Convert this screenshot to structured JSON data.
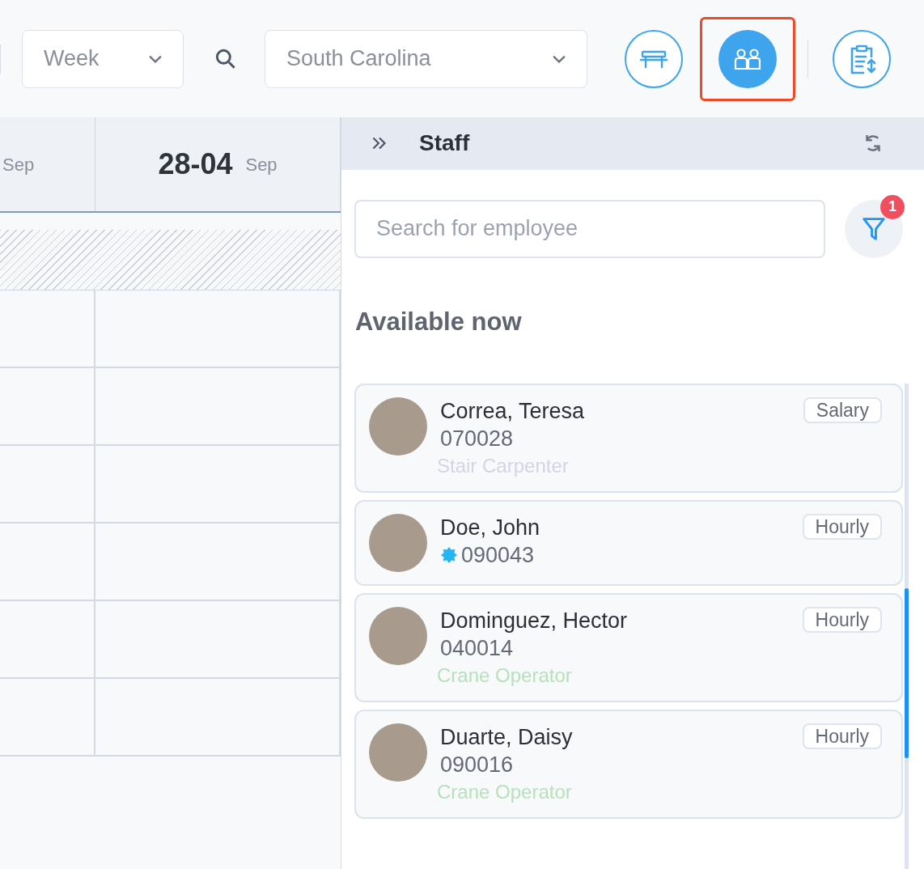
{
  "toolbar": {
    "view_select": {
      "value": "Week"
    },
    "location_select": {
      "value": "South Carolina"
    },
    "buttons": [
      {
        "kind": "bench",
        "selected": false
      },
      {
        "kind": "staff",
        "selected": true
      },
      {
        "kind": "clipboard",
        "selected": false
      }
    ]
  },
  "calendar": {
    "columns": [
      {
        "month": "Sep"
      },
      {
        "day": "28-04",
        "month": "Sep"
      }
    ]
  },
  "staff_panel": {
    "title": "Staff",
    "search": {
      "placeholder": "Search for employee"
    },
    "filter_count": "1",
    "section_title": "Available now",
    "employees": [
      {
        "name": "Correa, Teresa",
        "id": "070028",
        "verified": false,
        "pay_type": "Salary",
        "role": "Stair Carpenter",
        "color": "#d6d3e3"
      },
      {
        "name": "Doe, John",
        "id": "090043",
        "verified": true,
        "pay_type": "Hourly"
      },
      {
        "name": "Dominguez, Hector",
        "id": "040014",
        "verified": false,
        "pay_type": "Hourly",
        "role": "Crane Operator",
        "color": "#b9e0bd"
      },
      {
        "name": "Duarte, Daisy",
        "id": "090016",
        "verified": false,
        "pay_type": "Hourly",
        "role": "Crane Operator",
        "color": "#b9e0bd"
      }
    ]
  }
}
